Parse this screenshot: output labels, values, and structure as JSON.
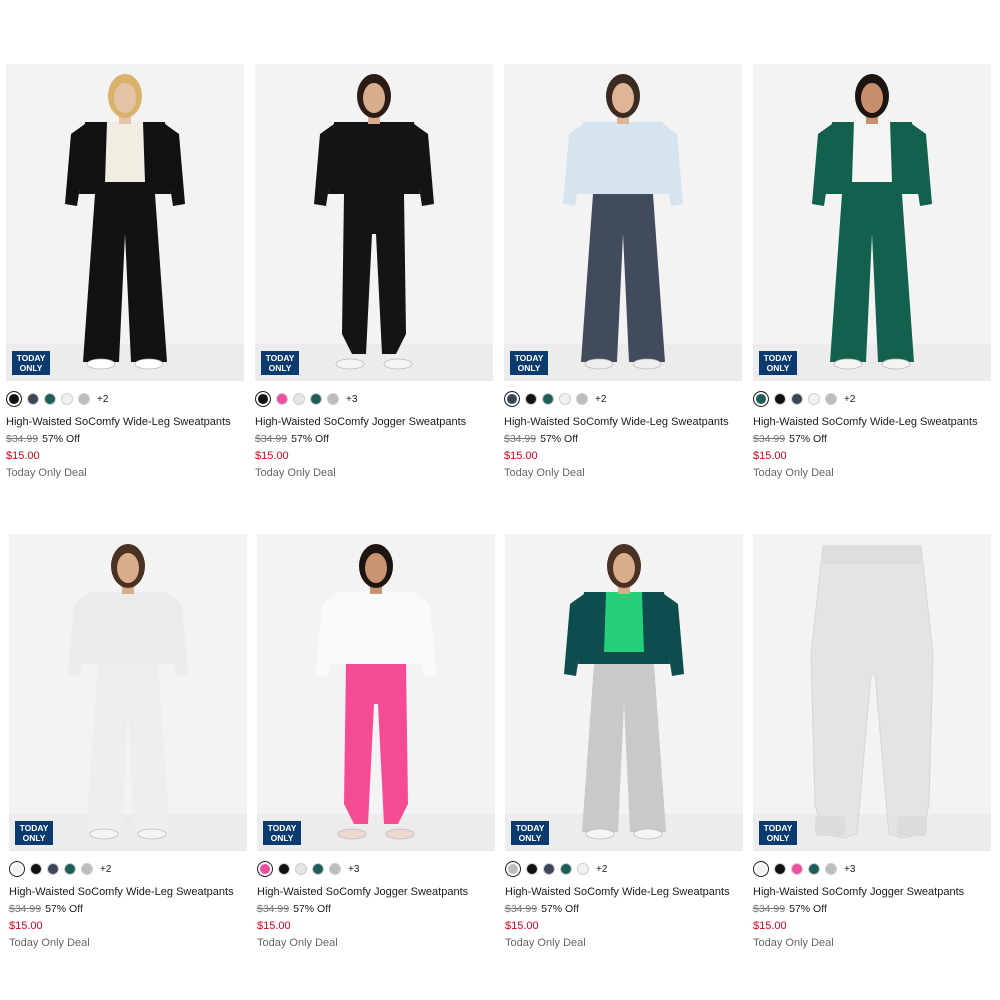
{
  "products": [
    {
      "name": "High-Waisted SoComfy Wide-Leg Sweatpants",
      "original_price": "$34.99",
      "discount": "57% Off",
      "sale_price": "$15.00",
      "deal": "Today Only Deal",
      "badge": [
        "TODAY",
        "ONLY"
      ],
      "swatches": [
        "#111111",
        "#3b4656",
        "#1f5e58",
        "#f2f2f2",
        "#bdbdbd"
      ],
      "selected": 0,
      "more": "+2",
      "figure": {
        "top": "#f1ede2",
        "jacket": "#111111",
        "pants": "#121212",
        "skin": "#e6c3a6",
        "hair": "#d9b36b",
        "shoes": "#ffffff",
        "type": "wide"
      }
    },
    {
      "name": "High-Waisted SoComfy Jogger Sweatpants",
      "original_price": "$34.99",
      "discount": "57% Off",
      "sale_price": "$15.00",
      "deal": "Today Only Deal",
      "badge": [
        "TODAY",
        "ONLY"
      ],
      "swatches": [
        "#111111",
        "#ee4fa0",
        "#e5e5e5",
        "#1f5e58",
        "#bdbdbd"
      ],
      "selected": 0,
      "more": "+3",
      "figure": {
        "top": "#141414",
        "jacket": "#141414",
        "pants": "#141414",
        "skin": "#d8ad8c",
        "hair": "#2a1c14",
        "shoes": "#f4f4f4",
        "type": "jogger"
      }
    },
    {
      "name": "High-Waisted SoComfy Wide-Leg Sweatpants",
      "original_price": "$34.99",
      "discount": "57% Off",
      "sale_price": "$15.00",
      "deal": "Today Only Deal",
      "badge": [
        "TODAY",
        "ONLY"
      ],
      "swatches": [
        "#3b4656",
        "#111111",
        "#1f5e58",
        "#f2f2f2",
        "#bdbdbd"
      ],
      "selected": 0,
      "more": "+2",
      "figure": {
        "top": "#d6e4ef",
        "jacket": "#d6e4ef",
        "pants": "#414b5c",
        "skin": "#e0b595",
        "hair": "#3a2a20",
        "shoes": "#eeeeee",
        "type": "wide"
      }
    },
    {
      "name": "High-Waisted SoComfy Wide-Leg Sweatpants",
      "original_price": "$34.99",
      "discount": "57% Off",
      "sale_price": "$15.00",
      "deal": "Today Only Deal",
      "badge": [
        "TODAY",
        "ONLY"
      ],
      "swatches": [
        "#1f5e58",
        "#111111",
        "#3b4656",
        "#f2f2f2",
        "#bdbdbd"
      ],
      "selected": 0,
      "more": "+2",
      "figure": {
        "top": "#f5f5f5",
        "jacket": "#13604f",
        "pants": "#13604f",
        "skin": "#c98f6d",
        "hair": "#1c1410",
        "shoes": "#f4f4f4",
        "type": "wide"
      }
    },
    {
      "name": "High-Waisted SoComfy Wide-Leg Sweatpants",
      "original_price": "$34.99",
      "discount": "57% Off",
      "sale_price": "$15.00",
      "deal": "Today Only Deal",
      "badge": [
        "TODAY",
        "ONLY"
      ],
      "swatches": [
        "#f2f2f2",
        "#111111",
        "#3b4656",
        "#1f5e58",
        "#bdbdbd"
      ],
      "selected": 0,
      "more": "+2",
      "figure": {
        "top": "#e9ebed",
        "jacket": "#e9ebed",
        "pants": "#eceeef",
        "skin": "#d8ad8c",
        "hair": "#4a3222",
        "shoes": "#f4f4f4",
        "type": "wide"
      }
    },
    {
      "name": "High-Waisted SoComfy Jogger Sweatpants",
      "original_price": "$34.99",
      "discount": "57% Off",
      "sale_price": "$15.00",
      "deal": "Today Only Deal",
      "badge": [
        "TODAY",
        "ONLY"
      ],
      "swatches": [
        "#ee4fa0",
        "#111111",
        "#e5e5e5",
        "#1f5e58",
        "#bdbdbd"
      ],
      "selected": 0,
      "more": "+3",
      "figure": {
        "top": "#fafafa",
        "jacket": "#fafafa",
        "pants": "#f54b95",
        "skin": "#c99474",
        "hair": "#1e140f",
        "shoes": "#f1d8cf",
        "type": "jogger"
      }
    },
    {
      "name": "High-Waisted SoComfy Wide-Leg Sweatpants",
      "original_price": "$34.99",
      "discount": "57% Off",
      "sale_price": "$15.00",
      "deal": "Today Only Deal",
      "badge": [
        "TODAY",
        "ONLY"
      ],
      "swatches": [
        "#bdbdbd",
        "#111111",
        "#3b4656",
        "#1f5e58",
        "#f2f2f2"
      ],
      "selected": 0,
      "more": "+2",
      "figure": {
        "top": "#25d07a",
        "jacket": "#0d4d4d",
        "pants": "#c9c9c9",
        "skin": "#d8ad8c",
        "hair": "#4a3222",
        "shoes": "#f4f4f4",
        "type": "wide"
      }
    },
    {
      "name": "High-Waisted SoComfy Jogger Sweatpants",
      "original_price": "$34.99",
      "discount": "57% Off",
      "sale_price": "$15.00",
      "deal": "Today Only Deal",
      "badge": [
        "TODAY",
        "ONLY"
      ],
      "swatches": [
        "#f2f2f2",
        "#111111",
        "#ee4fa0",
        "#1f5e58",
        "#bdbdbd"
      ],
      "selected": 0,
      "more": "+3",
      "figure": {
        "pants": "#e4e4e4",
        "type": "flat"
      }
    }
  ]
}
